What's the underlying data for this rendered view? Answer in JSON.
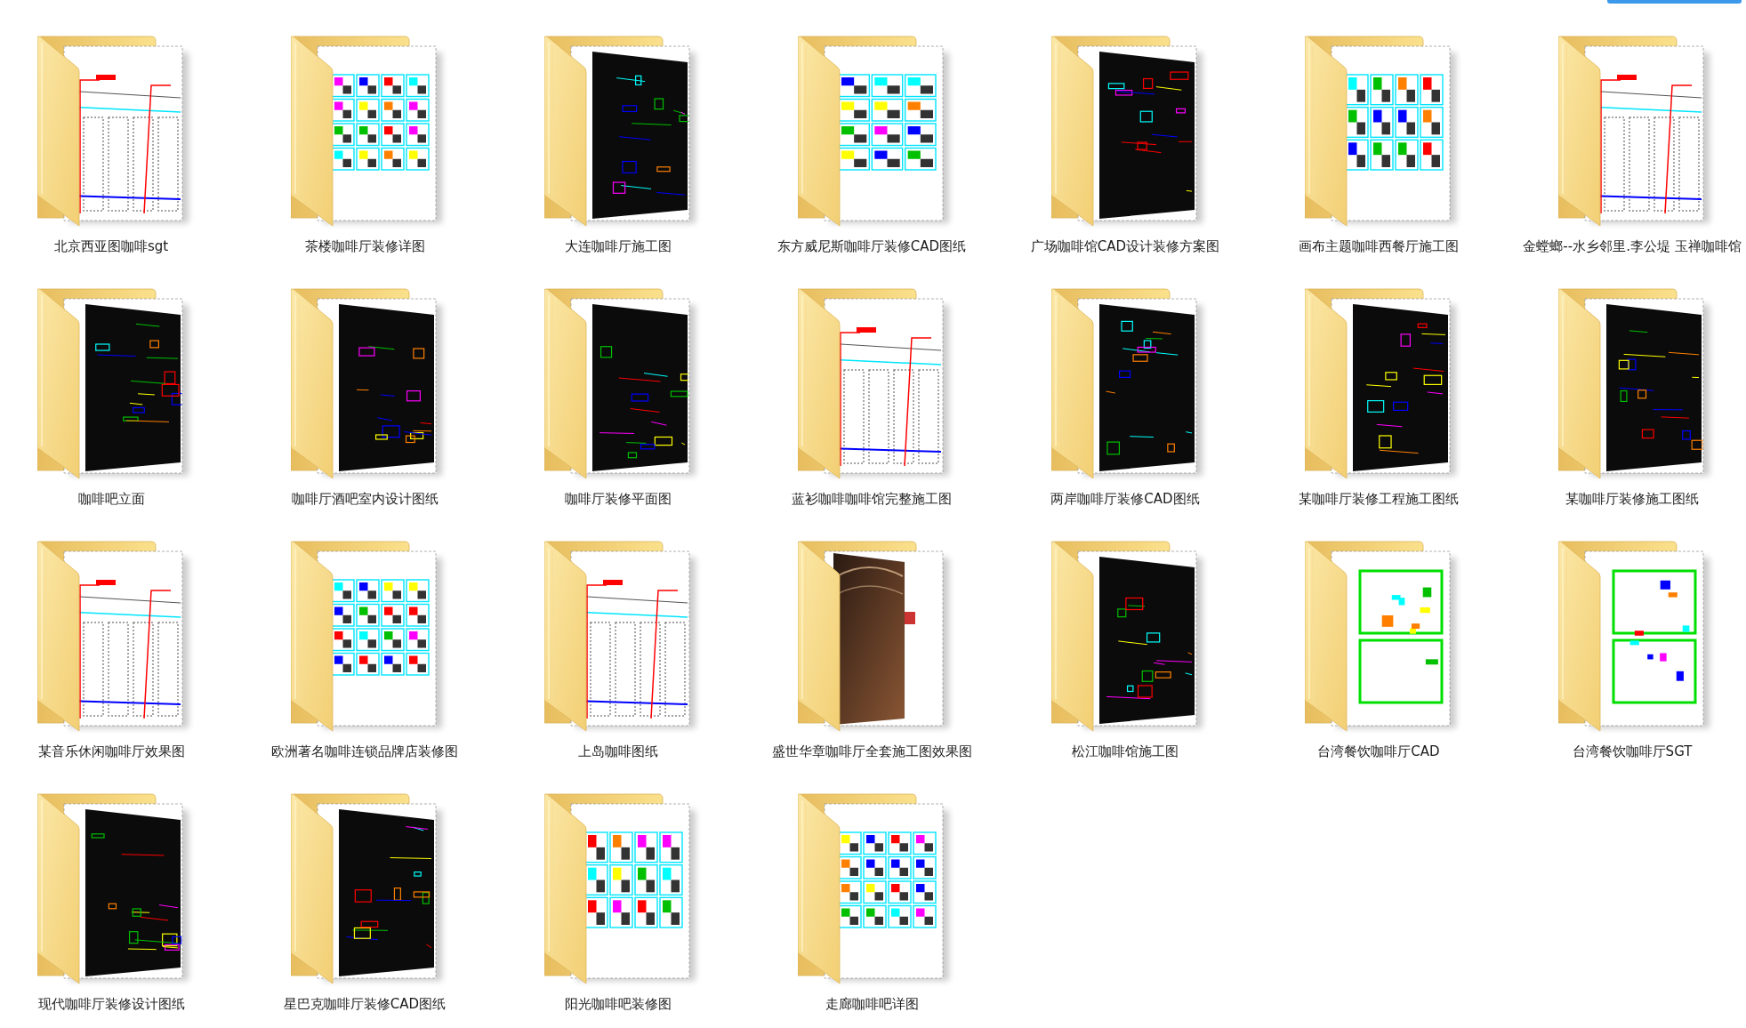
{
  "folders": [
    {
      "name": "北京西亚图咖啡sgt",
      "kind": "elevation"
    },
    {
      "name": "茶楼咖啡厅装修详图",
      "kind": "plan"
    },
    {
      "name": "大连咖啡厅施工图",
      "kind": "dark"
    },
    {
      "name": "东方威尼斯咖啡厅装修CAD图纸",
      "kind": "plan"
    },
    {
      "name": "广场咖啡馆CAD设计装修方案图",
      "kind": "dark"
    },
    {
      "name": "画布主题咖啡西餐厅施工图",
      "kind": "plan"
    },
    {
      "name": "金螳螂--水乡邻里.李公堤 玉禅咖啡馆",
      "kind": "elevation"
    },
    {
      "name": "咖啡吧立面",
      "kind": "dark"
    },
    {
      "name": "咖啡厅酒吧室内设计图纸",
      "kind": "dark"
    },
    {
      "name": "咖啡厅装修平面图",
      "kind": "dark"
    },
    {
      "name": "蓝衫咖啡咖啡馆完整施工图",
      "kind": "elevation"
    },
    {
      "name": "两岸咖啡厅装修CAD图纸",
      "kind": "dark"
    },
    {
      "name": "某咖啡厅装修工程施工图纸",
      "kind": "dark"
    },
    {
      "name": "某咖啡厅装修施工图纸",
      "kind": "dark"
    },
    {
      "name": "某音乐休闲咖啡厅效果图",
      "kind": "elevation"
    },
    {
      "name": "欧洲著名咖啡连锁品牌店装修图",
      "kind": "plan"
    },
    {
      "name": "上岛咖啡图纸",
      "kind": "elevation"
    },
    {
      "name": "盛世华章咖啡厅全套施工图效果图",
      "kind": "photo"
    },
    {
      "name": "松江咖啡馆施工图",
      "kind": "dark"
    },
    {
      "name": "台湾餐饮咖啡厅CAD",
      "kind": "frames"
    },
    {
      "name": "台湾餐饮咖啡厅SGT",
      "kind": "frames"
    },
    {
      "name": "现代咖啡厅装修设计图纸",
      "kind": "dark"
    },
    {
      "name": "星巴克咖啡厅装修CAD图纸",
      "kind": "dark"
    },
    {
      "name": "阳光咖啡吧装修图",
      "kind": "plan"
    },
    {
      "name": "走廊咖啡吧详图",
      "kind": "plan"
    }
  ]
}
